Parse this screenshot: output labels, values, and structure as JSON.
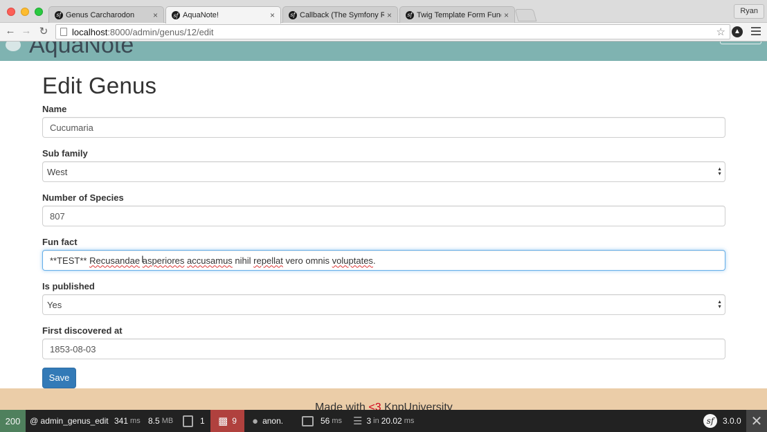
{
  "browser": {
    "tabs": [
      {
        "label": "Genus Carcharodon",
        "active": false
      },
      {
        "label": "AquaNote!",
        "active": true
      },
      {
        "label": "Callback (The Symfony Ref",
        "active": false
      },
      {
        "label": "Twig Template Form Functi",
        "active": false
      }
    ],
    "tab_close_glyph": "×",
    "profile_name": "Ryan",
    "url_host": "localhost",
    "url_rest": ":8000/admin/genus/12/edit"
  },
  "header": {
    "logo_text": "AquaNote"
  },
  "page": {
    "title": "Edit Genus",
    "fields": {
      "name": {
        "label": "Name",
        "value": "Cucumaria"
      },
      "subfamily": {
        "label": "Sub family",
        "value": "West"
      },
      "species": {
        "label": "Number of Species",
        "value": "807"
      },
      "funfact": {
        "label": "Fun fact",
        "value": "**TEST** Recusandae asperiores accusamus nihil repellat vero omnis voluptates."
      },
      "published": {
        "label": "Is published",
        "value": "Yes"
      },
      "discovered": {
        "label": "First discovered at",
        "value": "1853-08-03"
      }
    },
    "save_label": "Save"
  },
  "footer": {
    "text_before": "Made with ",
    "heart": "<3",
    "text_after": " KnpUniversity"
  },
  "symfony_toolbar": {
    "status_code": "200",
    "route": "@ admin_genus_edit",
    "time_value": "341",
    "time_unit": "ms",
    "memory_value": "8.5",
    "memory_unit": "MB",
    "logs_count": "1",
    "warnings_count": "9",
    "user": "anon.",
    "render_value": "56",
    "render_unit": "ms",
    "db_queries": "3",
    "db_in": "in",
    "db_time": "20.02",
    "db_unit": "ms",
    "version": "3.0.0"
  },
  "colors": {
    "header_bg": "#7fb3b1",
    "footer_bg": "#ebcda8",
    "save_button": "#337ab7",
    "status_ok": "#4f805d",
    "warning_badge": "#b0413e"
  }
}
